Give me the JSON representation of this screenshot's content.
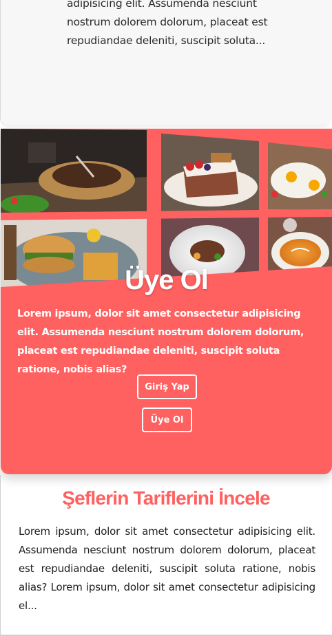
{
  "top_card": {
    "text": "adipisicing elit. Assumenda nesciunt nostrum dolorem dolorum, placeat est repudiandae deleniti, suscipit soluta..."
  },
  "membership": {
    "title": "Üye Ol",
    "text": "Lorem ipsum, dolor sit amet consectetur adipisicing elit. Assumenda nesciunt nostrum dolorem dolorum, placeat est repudiandae deleniti, suscipit soluta ratione, nobis alias?",
    "login_label": "Giriş Yap",
    "signup_label": "Üye Ol",
    "colors": {
      "accent": "#ff6060",
      "button_border": "#ffffff"
    }
  },
  "chefs": {
    "title": "Şeflerin Tariflerini İncele",
    "text": "Lorem ipsum, dolor sit amet consectetur adipisicing elit. Assumenda nesciunt nostrum dolorem dolorum, placeat est repudiandae deleniti, suscipit soluta ratione, nobis alias? Lorem ipsum, dolor sit amet consectetur adipisicing el..."
  },
  "collage_images": [
    "grilled-steak-photo",
    "strawberry-cake-photo",
    "fried-eggs-photo",
    "burger-fries-photo",
    "meat-plate-photo",
    "pumpkin-soup-photo"
  ]
}
